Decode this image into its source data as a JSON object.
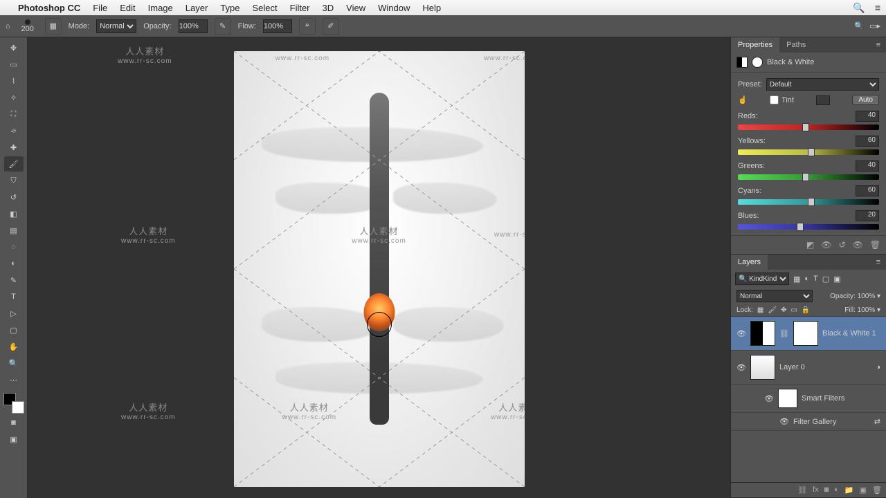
{
  "menubar": {
    "app": "Photoshop CC",
    "items": [
      "File",
      "Edit",
      "Image",
      "Layer",
      "Type",
      "Select",
      "Filter",
      "3D",
      "View",
      "Window",
      "Help"
    ]
  },
  "options": {
    "brush_size": "200",
    "mode_label": "Mode:",
    "mode_value": "Normal",
    "opacity_label": "Opacity:",
    "opacity_value": "100%",
    "flow_label": "Flow:",
    "flow_value": "100%"
  },
  "watermark": {
    "cn": "人人素材",
    "url": "www.rr-sc.com"
  },
  "properties": {
    "tab_properties": "Properties",
    "tab_paths": "Paths",
    "title": "Black & White",
    "preset_label": "Preset:",
    "preset_value": "Default",
    "tint_label": "Tint",
    "auto_label": "Auto",
    "sliders": {
      "reds": {
        "label": "Reds:",
        "value": "40",
        "pos": 48
      },
      "yellows": {
        "label": "Yellows:",
        "value": "60",
        "pos": 52
      },
      "greens": {
        "label": "Greens:",
        "value": "40",
        "pos": 48
      },
      "cyans": {
        "label": "Cyans:",
        "value": "60",
        "pos": 52
      },
      "blues": {
        "label": "Blues:",
        "value": "20",
        "pos": 44
      }
    }
  },
  "layers": {
    "tab": "Layers",
    "kind": "Kind",
    "blend": "Normal",
    "opacity_label": "Opacity:",
    "opacity_value": "100%",
    "lock_label": "Lock:",
    "fill_label": "Fill:",
    "fill_value": "100%",
    "items": {
      "bw": "Black & White 1",
      "layer0": "Layer 0",
      "smart": "Smart Filters",
      "filtergallery": "Filter Gallery"
    }
  }
}
